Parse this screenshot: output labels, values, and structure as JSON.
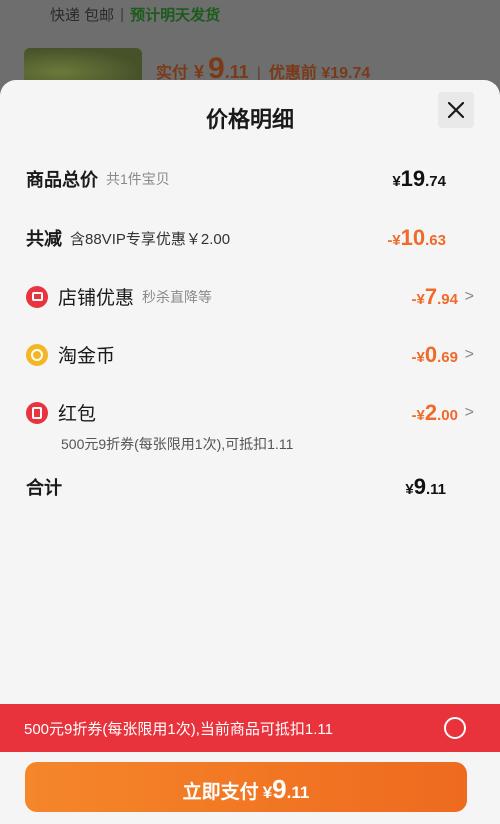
{
  "background": {
    "shipping_label": "快递 包邮",
    "shipping_separator": "|",
    "ship_time": "预计明天发货",
    "paid_label": "实付",
    "paid_currency": "¥",
    "paid_int": "9",
    "paid_dec": ".11",
    "separator": "|",
    "before_label": "优惠前 ¥19.74"
  },
  "sheet": {
    "title": "价格明细",
    "close_icon": "close-icon"
  },
  "rows": {
    "total": {
      "label": "商品总价",
      "sub": "共1件宝贝",
      "currency": "¥",
      "int": "19",
      "dec": ".74"
    },
    "discount": {
      "label": "共减",
      "sub": "含88VIP专享优惠￥2.00",
      "currency": "-¥",
      "int": "10",
      "dec": ".63"
    },
    "shop": {
      "icon": "shop-coupon-icon",
      "label": "店铺优惠",
      "sub": "秒杀直降等",
      "currency": "-¥",
      "int": "7",
      "dec": ".94",
      "chevron": ">"
    },
    "coin": {
      "icon": "taojinbi-icon",
      "label": "淘金币",
      "currency": "-¥",
      "int": "0",
      "dec": ".69",
      "chevron": ">"
    },
    "redpacket": {
      "icon": "red-packet-icon",
      "label": "红包",
      "currency": "-¥",
      "int": "2",
      "dec": ".00",
      "chevron": ">",
      "detail": "500元9折券(每张限用1次),可抵扣1.11"
    },
    "sum": {
      "label": "合计",
      "currency": "¥",
      "int": "9",
      "dec": ".11"
    }
  },
  "promo_bar": {
    "text": "500元9折券(每张限用1次),当前商品可抵扣1.11"
  },
  "pay_button": {
    "label": "立即支付",
    "currency": "¥",
    "int": "9",
    "dec": ".11"
  },
  "colors": {
    "accent_orange": "#f06a2a",
    "promo_red": "#e8323c",
    "button_orange": "#f07a25"
  }
}
